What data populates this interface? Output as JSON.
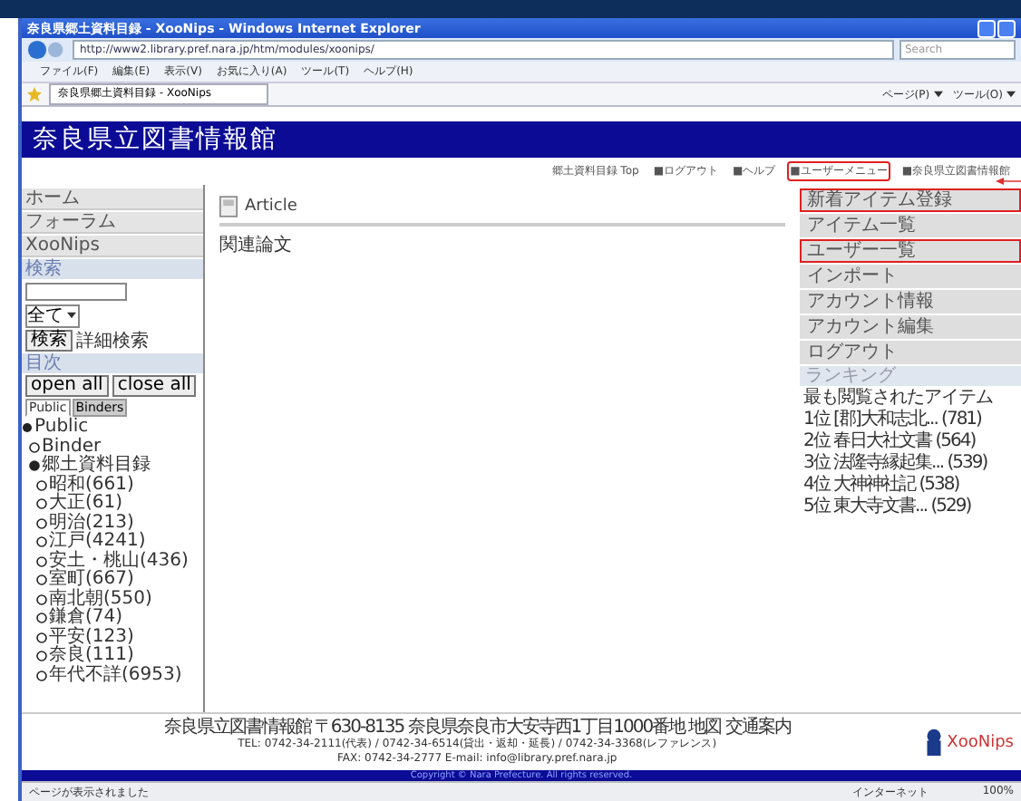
{
  "window": {
    "title": "奈良県郷土資料目録 - XooNips - Windows Internet Explorer",
    "address": "http://www2.library.pref.nara.jp/htm/modules/xoonips/",
    "search_placeholder": "Search"
  },
  "menu": [
    "ファイル(F)",
    "編集(E)",
    "表示(V)",
    "お気に入り(A)",
    "ツール(T)",
    "ヘルプ(H)"
  ],
  "tab": {
    "title": "奈良県郷土資料目録 - XooNips"
  },
  "toolbar_right": [
    "ページ(P)",
    "ツール(O)"
  ],
  "site": {
    "logo": "奈良県立図書情報館"
  },
  "top_links": [
    {
      "label": "郷土資料目録 Top",
      "highlighted": false
    },
    {
      "label": "■ログアウト",
      "highlighted": false
    },
    {
      "label": "■ヘルプ",
      "highlighted": false
    },
    {
      "label": "■ユーザーメニュー",
      "highlighted": true
    },
    {
      "label": "■奈良県立図書情報館",
      "highlighted": false
    }
  ],
  "sidebar": {
    "nav": [
      "ホーム",
      "フォーラム",
      "XooNips"
    ],
    "search_title": "検索",
    "scope": "全て",
    "search_button": "検索",
    "advanced": "詳細検索",
    "index_title": "目次",
    "open_all": "open all",
    "close_all": "close all",
    "tabs": [
      {
        "label": "Public",
        "selected": true
      },
      {
        "label": "Binders",
        "selected": false
      }
    ],
    "tree": [
      {
        "label": "Public",
        "children": [
          {
            "label": "Binder"
          },
          {
            "label": "郷土資料目録",
            "children": [
              {
                "label": "昭和(661)"
              },
              {
                "label": "大正(61)"
              },
              {
                "label": "明治(213)"
              },
              {
                "label": "江戸(4241)"
              },
              {
                "label": "安土・桃山(436)"
              },
              {
                "label": "室町(667)"
              },
              {
                "label": "南北朝(550)"
              },
              {
                "label": "鎌倉(74)"
              },
              {
                "label": "平安(123)"
              },
              {
                "label": "奈良(111)"
              },
              {
                "label": "年代不詳(6953)"
              }
            ]
          }
        ]
      }
    ]
  },
  "main": {
    "title": "Article",
    "text": "関連論文"
  },
  "user_menu": [
    {
      "label": "新着アイテム登録",
      "highlighted": true
    },
    {
      "label": "アイテム一覧",
      "highlighted": false
    },
    {
      "label": "ユーザー一覧",
      "highlighted": true
    },
    {
      "label": "インポート",
      "highlighted": false
    },
    {
      "label": "アカウント情報",
      "highlighted": false
    },
    {
      "label": "アカウント編集",
      "highlighted": false
    },
    {
      "label": "ログアウト",
      "highlighted": false
    }
  ],
  "ranking": {
    "title": "ランキング",
    "subtitle": "最も閲覧されたアイテム",
    "items": [
      "1位 [郡]大和志北... (781)",
      "2位 春日大社文書 (564)",
      "3位 法隆寺縁起集... (539)",
      "4位 大神神社記 (538)",
      "5位 東大寺文書... (529)"
    ]
  },
  "footer": {
    "lines": [
      "奈良県立図書情報館 〒630-8135 奈良県奈良市大安寺西1丁目1000番地 地図 交通案内",
      "TEL: 0742-34-2111(代表) / 0742-34-6514(貸出・返却・延長) / 0742-34-3368(レファレンス)",
      "FAX: 0742-34-2777 E-mail: info@library.pref.nara.jp"
    ],
    "copyright": "Copyright © Nara Prefecture. All rights reserved.",
    "logo": "XooNips"
  },
  "status_bar": {
    "text": "ページが表示されました",
    "zone": "インターネット",
    "zoom": "100%"
  }
}
